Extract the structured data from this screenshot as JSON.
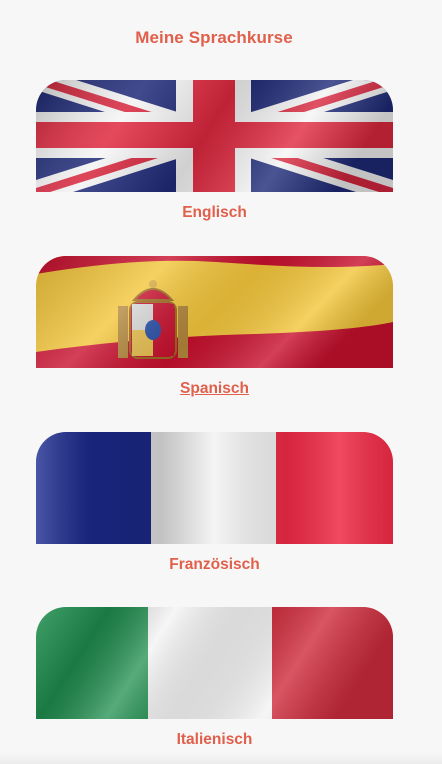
{
  "page": {
    "title": "Meine Sprachkurse"
  },
  "courses": [
    {
      "id": "en",
      "label": "Englisch",
      "flag_icon": "uk-flag-icon",
      "underlined": false
    },
    {
      "id": "es",
      "label": "Spanisch",
      "flag_icon": "spain-flag-icon",
      "underlined": true
    },
    {
      "id": "fr",
      "label": "Französisch",
      "flag_icon": "france-flag-icon",
      "underlined": false
    },
    {
      "id": "it",
      "label": "Italienisch",
      "flag_icon": "italy-flag-icon",
      "underlined": false
    }
  ],
  "colors": {
    "accent": "#e0604b",
    "background": "#f7f7f7"
  }
}
